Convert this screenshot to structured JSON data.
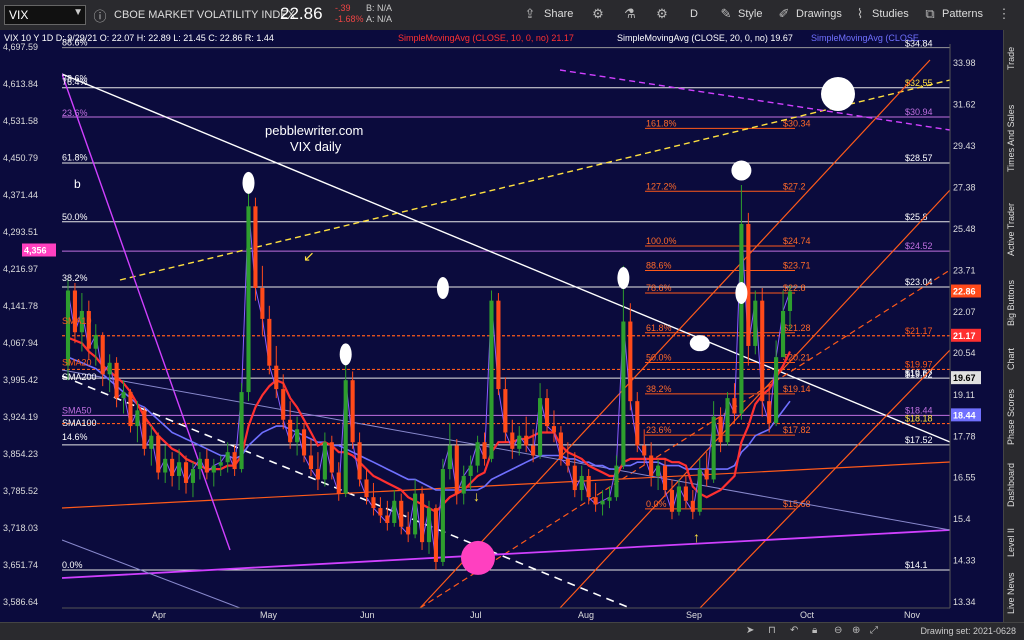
{
  "toolbar": {
    "symbol": "VIX",
    "name": "CBOE MARKET VOLATILITY INDEX",
    "price": "22.86",
    "change": "-.39",
    "change_pct": "-1.68%",
    "bid": "B: N/A",
    "ask": "A: N/A",
    "share_label": "Share",
    "period_label": "D",
    "style_label": "Style",
    "drawings_label": "Drawings",
    "studies_label": "Studies",
    "patterns_label": "Patterns"
  },
  "right_tabs": [
    "Trade",
    "Times And Sales",
    "Active Trader",
    "Big Buttons",
    "Chart",
    "Phase Scores",
    "Dashboard",
    "Level II",
    "Live News"
  ],
  "bottom": {
    "drawing_set": "Drawing set: 2021-0628"
  },
  "colors": {
    "bg": "#0b0b3d",
    "up": "#2e9e2e",
    "down": "#ff4a1a",
    "price_line": "#8a5cff",
    "sma10": "#ff3030",
    "sma20": "#7070ff"
  },
  "chart_data": {
    "type": "candlestick",
    "header": {
      "line": "VIX 10 Y 1D  D: 9/29/21  O: 22.07  H: 22.89  L: 21.45  C: 22.86  R: 1.44",
      "sma10": "SimpleMovingAvg (CLOSE, 10, 0, no)  21.17",
      "sma20": "SimpleMovingAvg (CLOSE, 20, 0, no)  19.67",
      "sma_other": "SimpleMovingAvg (CLOSE..."
    },
    "annotation": [
      "pebblewriter.com",
      "VIX daily"
    ],
    "x_ticks": [
      "Apr",
      "May",
      "Jun",
      "Jul",
      "Aug",
      "Sep",
      "Oct",
      "Nov"
    ],
    "left_axis": [
      "4,697.59",
      "4,613.84",
      "4,531.58",
      "4,450.79",
      "4,371.44",
      "4,293.51",
      "4,216.97",
      "4,141.78",
      "4,067.94",
      "3,995.42",
      "3,924.19",
      "3,854.23",
      "3,785.52",
      "3,718.03",
      "3,651.74",
      "3,586.64"
    ],
    "right_axis": [
      "33.98",
      "31.62",
      "29.43",
      "27.38",
      "25.48",
      "23.71",
      "22.07",
      "20.54",
      "19.11",
      "17.78",
      "16.55",
      "15.4",
      "14.33",
      "13.34"
    ],
    "right_badges": [
      {
        "text": "22.86",
        "color": "#ff4a1a"
      },
      {
        "text": "21.17",
        "color": "#ff3030"
      },
      {
        "text": "19.67",
        "color": "#e0e0e0"
      },
      {
        "text": "18.44",
        "color": "#7070ff"
      }
    ],
    "left_badge": "4,356",
    "left_fib_labels": [
      "88.6%",
      "78.6%",
      "76.4%",
      "23.6%",
      "61.8%",
      "50.0%",
      "38.2%",
      "14.6%",
      "0.0%"
    ],
    "left_sma_labels": [
      "SMA10",
      "SMA20",
      "SMA200",
      "SMA50",
      "SMA100"
    ],
    "wave_label": "b",
    "fib_levels": [
      {
        "pct": "161.8%",
        "value": "$30.34"
      },
      {
        "pct": "127.2%",
        "value": "$27.2"
      },
      {
        "pct": "100.0%",
        "value": "$24.74"
      },
      {
        "pct": "88.6%",
        "value": "$23.71"
      },
      {
        "pct": "78.6%",
        "value": "$22.8"
      },
      {
        "pct": "61.8%",
        "value": "$21.28"
      },
      {
        "pct": "50.0%",
        "value": "$20.21"
      },
      {
        "pct": "38.2%",
        "value": "$19.14"
      },
      {
        "pct": "23.6%",
        "value": "$17.82"
      },
      {
        "pct": "0.0%",
        "value": "$15.68"
      }
    ],
    "right_level_labels": [
      "$34.84",
      "$32.55",
      "$30.94",
      "$28.57",
      "$25.8",
      "$24.52",
      "$23.04",
      "$21.17",
      "$19.97",
      "$19.67",
      "$19.62",
      "$18.44",
      "$18.18",
      "$17.52",
      "$14.1"
    ],
    "candles": [
      [
        20.1,
        23.4,
        19.6,
        22.9
      ],
      [
        22.9,
        23.2,
        20.9,
        21.3
      ],
      [
        21.3,
        22.8,
        20.6,
        22.1
      ],
      [
        22.1,
        22.5,
        20.3,
        20.7
      ],
      [
        20.7,
        21.6,
        20.1,
        21.2
      ],
      [
        21.2,
        21.3,
        19.4,
        19.8
      ],
      [
        19.8,
        20.5,
        19.2,
        20.2
      ],
      [
        20.2,
        20.4,
        18.7,
        19.0
      ],
      [
        19.0,
        19.6,
        18.5,
        19.2
      ],
      [
        19.2,
        19.3,
        17.9,
        18.1
      ],
      [
        18.1,
        18.9,
        17.6,
        18.6
      ],
      [
        18.6,
        18.7,
        17.2,
        17.4
      ],
      [
        17.4,
        18.1,
        16.9,
        17.8
      ],
      [
        17.8,
        17.9,
        16.5,
        16.7
      ],
      [
        16.7,
        17.5,
        16.4,
        17.1
      ],
      [
        17.1,
        17.3,
        16.3,
        16.6
      ],
      [
        16.6,
        17.4,
        16.2,
        17.0
      ],
      [
        17.0,
        17.2,
        16.1,
        16.4
      ],
      [
        16.4,
        17.0,
        16.0,
        16.8
      ],
      [
        16.8,
        17.3,
        16.5,
        17.1
      ],
      [
        17.1,
        17.4,
        16.5,
        16.7
      ],
      [
        16.7,
        17.1,
        16.3,
        16.9
      ],
      [
        16.9,
        17.2,
        16.6,
        17.0
      ],
      [
        17.0,
        17.6,
        16.7,
        17.3
      ],
      [
        17.3,
        17.5,
        16.6,
        16.8
      ],
      [
        16.8,
        19.5,
        16.7,
        19.2
      ],
      [
        19.2,
        27.5,
        18.9,
        26.5
      ],
      [
        26.5,
        26.9,
        22.5,
        23.0
      ],
      [
        23.0,
        23.9,
        21.2,
        21.8
      ],
      [
        21.8,
        22.3,
        19.8,
        20.1
      ],
      [
        20.1,
        20.8,
        19.0,
        19.3
      ],
      [
        19.3,
        19.8,
        18.0,
        18.3
      ],
      [
        18.3,
        18.9,
        17.4,
        17.6
      ],
      [
        17.6,
        18.4,
        17.2,
        18.0
      ],
      [
        18.0,
        18.2,
        17.0,
        17.2
      ],
      [
        17.2,
        17.7,
        16.6,
        16.8
      ],
      [
        16.8,
        17.3,
        16.2,
        16.5
      ],
      [
        16.5,
        17.9,
        16.3,
        17.6
      ],
      [
        17.6,
        17.8,
        16.5,
        16.7
      ],
      [
        16.7,
        17.0,
        15.9,
        16.1
      ],
      [
        16.1,
        20.7,
        16.0,
        19.6
      ],
      [
        19.6,
        19.9,
        17.4,
        17.6
      ],
      [
        17.6,
        17.9,
        16.3,
        16.5
      ],
      [
        16.5,
        16.8,
        15.8,
        16.0
      ],
      [
        16.0,
        16.4,
        15.5,
        15.7
      ],
      [
        15.7,
        16.0,
        15.3,
        15.5
      ],
      [
        15.5,
        15.9,
        15.1,
        15.3
      ],
      [
        15.3,
        16.2,
        15.2,
        15.9
      ],
      [
        15.9,
        16.1,
        15.0,
        15.2
      ],
      [
        15.2,
        15.6,
        14.8,
        15.0
      ],
      [
        15.0,
        16.5,
        14.9,
        16.1
      ],
      [
        16.1,
        16.3,
        14.6,
        14.8
      ],
      [
        14.8,
        15.9,
        14.5,
        15.7
      ],
      [
        15.7,
        15.8,
        14.1,
        14.3
      ],
      [
        14.3,
        17.1,
        14.2,
        16.8
      ],
      [
        16.8,
        18.2,
        16.5,
        17.5
      ],
      [
        17.5,
        17.7,
        15.8,
        16.1
      ],
      [
        16.1,
        16.9,
        15.8,
        16.6
      ],
      [
        16.6,
        17.2,
        16.2,
        16.9
      ],
      [
        16.9,
        17.8,
        16.7,
        17.6
      ],
      [
        17.6,
        17.9,
        16.9,
        17.1
      ],
      [
        17.1,
        22.9,
        17.0,
        22.5
      ],
      [
        22.5,
        22.8,
        19.1,
        19.3
      ],
      [
        19.3,
        19.7,
        17.6,
        17.9
      ],
      [
        17.9,
        18.3,
        17.1,
        17.4
      ],
      [
        17.4,
        18.1,
        17.2,
        17.8
      ],
      [
        17.8,
        18.4,
        17.3,
        17.5
      ],
      [
        17.5,
        18.0,
        17.0,
        17.2
      ],
      [
        17.2,
        19.5,
        17.1,
        19.0
      ],
      [
        19.0,
        19.3,
        17.9,
        18.1
      ],
      [
        18.1,
        18.6,
        17.6,
        17.9
      ],
      [
        17.9,
        18.1,
        16.9,
        17.1
      ],
      [
        17.1,
        17.6,
        16.7,
        16.9
      ],
      [
        16.9,
        17.3,
        16.0,
        16.2
      ],
      [
        16.2,
        16.9,
        15.9,
        16.6
      ],
      [
        16.6,
        16.8,
        15.8,
        16.0
      ],
      [
        16.0,
        16.4,
        15.6,
        15.8
      ],
      [
        15.8,
        16.2,
        15.5,
        15.9
      ],
      [
        15.9,
        16.3,
        15.7,
        16.0
      ],
      [
        16.0,
        17.2,
        15.9,
        16.9
      ],
      [
        16.9,
        23.9,
        16.8,
        21.7
      ],
      [
        21.7,
        22.4,
        18.6,
        18.9
      ],
      [
        18.9,
        19.2,
        17.3,
        17.5
      ],
      [
        17.5,
        18.0,
        16.9,
        17.2
      ],
      [
        17.2,
        17.6,
        16.3,
        16.6
      ],
      [
        16.6,
        17.1,
        16.2,
        16.9
      ],
      [
        16.9,
        17.1,
        16.0,
        16.2
      ],
      [
        16.2,
        16.5,
        15.4,
        15.6
      ],
      [
        15.6,
        16.5,
        15.5,
        16.3
      ],
      [
        16.3,
        16.6,
        15.7,
        15.9
      ],
      [
        15.9,
        16.2,
        15.4,
        15.6
      ],
      [
        15.6,
        17.1,
        15.5,
        16.8
      ],
      [
        16.8,
        17.3,
        16.3,
        16.5
      ],
      [
        16.5,
        18.9,
        16.4,
        18.4
      ],
      [
        18.4,
        18.7,
        17.3,
        17.6
      ],
      [
        17.6,
        19.2,
        17.5,
        19.0
      ],
      [
        19.0,
        19.5,
        18.2,
        18.5
      ],
      [
        18.5,
        27.5,
        18.3,
        25.7
      ],
      [
        25.7,
        26.2,
        20.1,
        20.8
      ],
      [
        20.8,
        22.9,
        20.5,
        22.5
      ],
      [
        22.5,
        23.0,
        18.4,
        18.9
      ],
      [
        18.9,
        19.4,
        17.9,
        18.2
      ],
      [
        18.2,
        21.0,
        18.1,
        20.4
      ],
      [
        20.4,
        22.9,
        21.2,
        22.1
      ],
      [
        22.1,
        23.1,
        21.4,
        22.86
      ]
    ],
    "close_line": [
      22.9,
      21.3,
      22.1,
      20.7,
      21.2,
      19.8,
      20.2,
      19.0,
      19.2,
      18.1,
      18.6,
      17.4,
      17.8,
      16.7,
      17.1,
      16.6,
      17.0,
      16.4,
      16.8,
      17.1,
      16.7,
      16.9,
      17.0,
      17.3,
      16.8,
      19.2,
      26.5,
      23.0,
      21.8,
      20.1,
      19.3,
      18.3,
      17.6,
      18.0,
      17.2,
      16.8,
      16.5,
      17.6,
      16.7,
      16.1,
      19.6,
      17.6,
      16.5,
      16.0,
      15.7,
      15.5,
      15.3,
      15.9,
      15.2,
      15.0,
      16.1,
      14.8,
      15.7,
      14.3,
      16.8,
      17.5,
      16.1,
      16.6,
      16.9,
      17.6,
      17.1,
      22.5,
      19.3,
      17.9,
      17.4,
      17.8,
      17.5,
      17.2,
      19.0,
      18.1,
      17.9,
      17.1,
      16.9,
      16.2,
      16.6,
      16.0,
      15.8,
      15.9,
      16.0,
      16.9,
      21.7,
      18.9,
      17.5,
      17.2,
      16.6,
      16.9,
      16.2,
      15.6,
      16.3,
      15.9,
      15.6,
      16.8,
      16.5,
      18.4,
      17.6,
      19.0,
      18.5,
      25.7,
      20.8,
      22.5,
      18.9,
      18.2,
      20.4,
      22.1,
      22.86
    ],
    "sma10_values": [
      21.1,
      21.0,
      20.9,
      20.6,
      20.4,
      20.1,
      19.9,
      19.7,
      19.5,
      19.2,
      18.8,
      18.4,
      18.1,
      17.8,
      17.6,
      17.4,
      17.3,
      17.1,
      17.0,
      16.9,
      16.8,
      16.8,
      16.8,
      16.9,
      16.9,
      17.2,
      18.1,
      18.7,
      19.1,
      19.4,
      19.6,
      19.5,
      19.0,
      18.7,
      18.3,
      17.9,
      17.5,
      17.6,
      17.5,
      17.3,
      17.3,
      17.2,
      17.0,
      16.8,
      16.6,
      16.5,
      16.4,
      16.3,
      16.2,
      16.0,
      15.9,
      15.8,
      15.7,
      15.6,
      15.8,
      16.0,
      16.1,
      16.2,
      16.4,
      16.6,
      16.7,
      17.3,
      17.6,
      17.6,
      17.6,
      17.7,
      17.7,
      17.8,
      17.9,
      17.9,
      17.9,
      17.5,
      17.3,
      17.2,
      17.1,
      16.9,
      16.8,
      16.7,
      16.6,
      16.6,
      17.0,
      17.1,
      17.1,
      17.1,
      17.1,
      17.1,
      17.1,
      17.0,
      17.0,
      16.9,
      16.3,
      16.1,
      16.0,
      16.1,
      16.2,
      16.4,
      16.6,
      17.6,
      18.1,
      18.8,
      19.1,
      19.3,
      19.7,
      20.1,
      20.6
    ],
    "sma20_values": [
      20.4,
      20.3,
      20.2,
      20.1,
      20.0,
      19.8,
      19.6,
      19.4,
      19.2,
      19.0,
      18.8,
      18.7,
      18.5,
      18.3,
      18.1,
      17.9,
      17.8,
      17.7,
      17.6,
      17.5,
      17.4,
      17.3,
      17.2,
      17.2,
      17.1,
      17.2,
      17.5,
      17.7,
      17.9,
      18.0,
      18.1,
      18.1,
      18.0,
      17.9,
      17.8,
      17.7,
      17.6,
      17.6,
      17.5,
      17.5,
      17.4,
      17.3,
      17.2,
      17.1,
      17.0,
      16.9,
      16.8,
      16.7,
      16.6,
      16.5,
      16.5,
      16.4,
      16.3,
      16.2,
      16.2,
      16.2,
      16.2,
      16.2,
      16.2,
      16.2,
      16.3,
      16.5,
      16.6,
      16.7,
      16.8,
      16.9,
      17.0,
      17.1,
      17.2,
      17.2,
      17.2,
      17.2,
      17.1,
      17.1,
      17.0,
      17.0,
      16.9,
      16.9,
      16.8,
      16.8,
      16.9,
      16.9,
      17.0,
      17.0,
      17.0,
      17.0,
      16.9,
      16.9,
      16.9,
      16.8,
      16.8,
      16.8,
      16.8,
      16.8,
      16.8,
      16.8,
      16.9,
      17.3,
      17.5,
      17.8,
      17.9,
      18.0,
      18.3,
      18.6,
      18.9
    ]
  }
}
